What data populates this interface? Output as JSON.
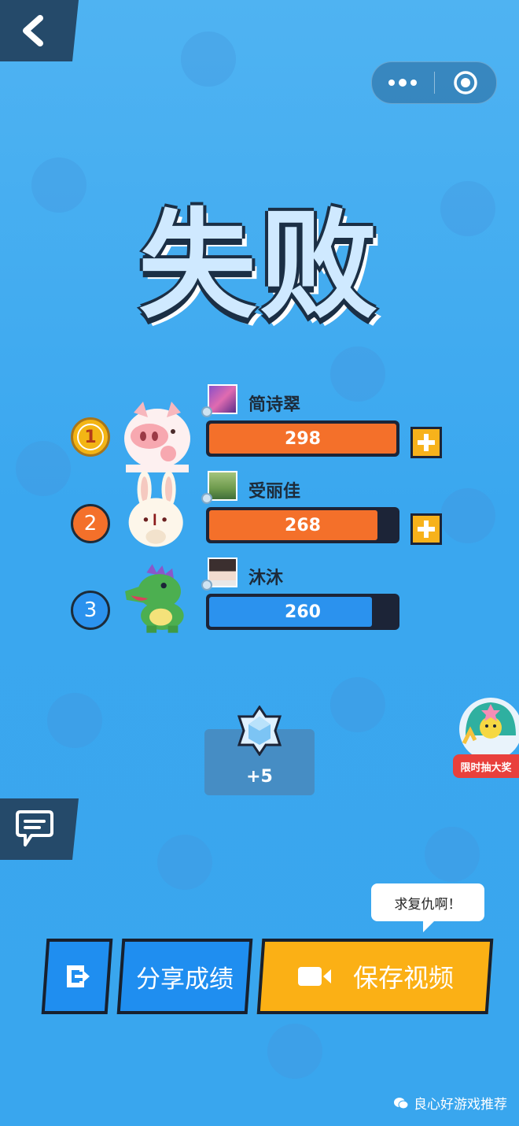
{
  "header": {
    "back_icon": "chevron-left-icon",
    "capsule": {
      "more_icon": "more-dots-icon",
      "close_icon": "target-circle-icon"
    }
  },
  "result": {
    "title": "失败"
  },
  "players": [
    {
      "rank": "1",
      "rank_color": "#f3b515",
      "name": "简诗翠",
      "score": "298",
      "score_fraction": 1.0,
      "bar_color": "#f4702a",
      "has_plus": true,
      "avatar": "pig-avatar"
    },
    {
      "rank": "2",
      "rank_color": "#f4702a",
      "name": "受丽佳",
      "score": "268",
      "score_fraction": 0.9,
      "bar_color": "#f4702a",
      "has_plus": true,
      "avatar": "rabbit-avatar"
    },
    {
      "rank": "3",
      "rank_color": "#2b92ee",
      "name": "沐沐",
      "score": "260",
      "score_fraction": 0.87,
      "bar_color": "#2b92ee",
      "has_plus": false,
      "avatar": "dinosaur-avatar"
    }
  ],
  "reward": {
    "amount": "+5",
    "icon": "diamond-icon"
  },
  "promo": {
    "label": "限时抽大奖"
  },
  "chat": {
    "icon": "chat-bubble-icon"
  },
  "speech_bubble": {
    "text": "求复仇啊！"
  },
  "buttons": {
    "exit_icon": "exit-icon",
    "share_label": "分享成绩",
    "save_label": "保存视频",
    "save_icon": "video-camera-icon"
  },
  "watermark": {
    "text": "良心好游戏推荐"
  },
  "colors": {
    "background": "#3aa7ef",
    "dark": "#1c2437",
    "orange": "#f4702a",
    "blue": "#2b92ee",
    "yellow": "#fbb015"
  }
}
